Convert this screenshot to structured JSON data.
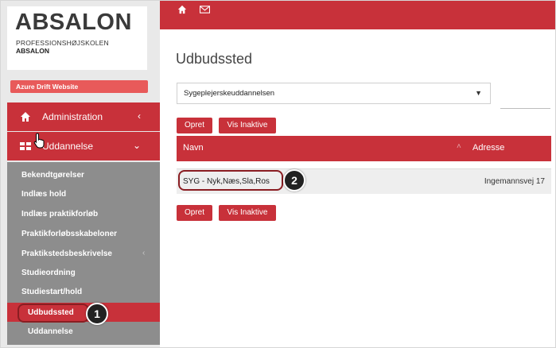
{
  "sidebar": {
    "logo": {
      "title": "ABSALON",
      "line1": "PROFESSIONSHØJSKOLEN",
      "line2": "ABSALON"
    },
    "badge": "Azure Drift Website",
    "nav": {
      "administration": "Administration",
      "uddannelse": "Uddannelse"
    },
    "sub_items": [
      "Bekendtgørelser",
      "Indlæs hold",
      "Indlæs praktikforløb",
      "Praktikforløbsskabeloner",
      "Praktikstedsbeskrivelse",
      "Studieordning",
      "Studiestart/hold",
      "Udbudssted",
      "Uddannelse"
    ],
    "active_item": "Udbudssted"
  },
  "topbar": {
    "home_icon": "home-icon",
    "mail_icon": "mail-icon"
  },
  "main": {
    "title": "Udbudssted",
    "select_value": "Sygeplejerskeuddannelsen",
    "buttons": {
      "create": "Opret",
      "show_inactive": "Vis Inaktive"
    },
    "table": {
      "headers": {
        "name": "Navn",
        "address": "Adresse"
      },
      "rows": [
        {
          "name": "SYG - Nyk,Næs,Sla,Ros",
          "address": "Ingemannsvej 17"
        }
      ]
    }
  },
  "annotations": {
    "step1": "1",
    "step2": "2"
  },
  "colors": {
    "brand_red": "#c8313a",
    "badge_red": "#e85a5a",
    "subnav_gray": "#8d8d8d",
    "sidebar_bg": "#e9e9e9"
  }
}
